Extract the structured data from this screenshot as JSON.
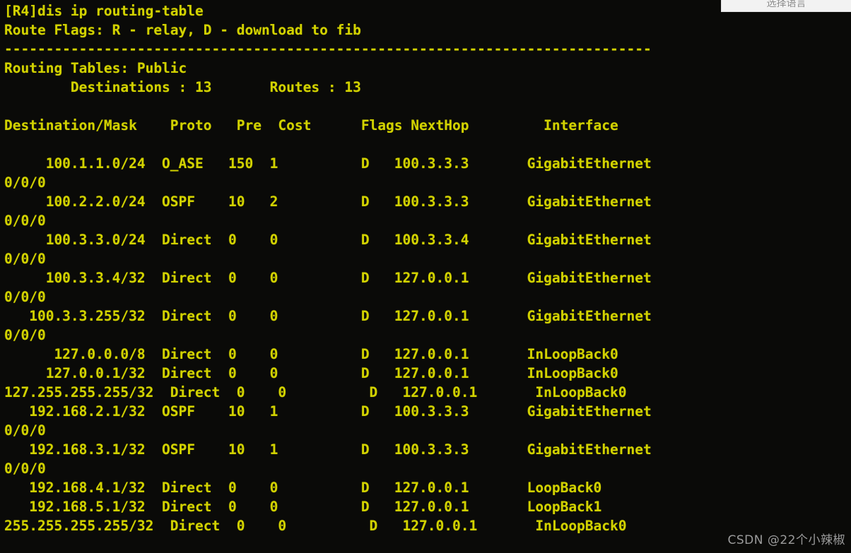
{
  "window": {
    "terminal_bg": "#0a0a08",
    "terminal_fg": "#d2d200"
  },
  "language_selector": {
    "label": "选择语言"
  },
  "watermark": {
    "text": "CSDN @22个小辣椒"
  },
  "terminal": {
    "prompt_line": "[R4]dis ip routing-table",
    "route_flags_line": "Route Flags: R - relay, D - download to fib",
    "separator": "------------------------------------------------------------------------------",
    "routing_tables_line": "Routing Tables: Public",
    "summary_line": "        Destinations : 13       Routes : 13",
    "destinations_label": "Destinations",
    "destinations_count": "13",
    "routes_label": "Routes",
    "routes_count": "13",
    "header_line": "Destination/Mask    Proto   Pre  Cost      Flags NextHop         Interface",
    "columns": [
      "Destination/Mask",
      "Proto",
      "Pre",
      "Cost",
      "Flags",
      "NextHop",
      "Interface"
    ],
    "rows": [
      {
        "destination": "100.1.1.0/24",
        "proto": "O_ASE",
        "pre": "150",
        "cost": "1",
        "flags": "D",
        "nexthop": "100.3.3.3",
        "interface": "GigabitEthernet",
        "interface_wrap": "0/0/0",
        "line": "     100.1.1.0/24  O_ASE   150  1          D   100.3.3.3       GigabitEthernet",
        "wrap_line": "0/0/0"
      },
      {
        "destination": "100.2.2.0/24",
        "proto": "OSPF",
        "pre": "10",
        "cost": "2",
        "flags": "D",
        "nexthop": "100.3.3.3",
        "interface": "GigabitEthernet",
        "interface_wrap": "0/0/0",
        "line": "     100.2.2.0/24  OSPF    10   2          D   100.3.3.3       GigabitEthernet",
        "wrap_line": "0/0/0"
      },
      {
        "destination": "100.3.3.0/24",
        "proto": "Direct",
        "pre": "0",
        "cost": "0",
        "flags": "D",
        "nexthop": "100.3.3.4",
        "interface": "GigabitEthernet",
        "interface_wrap": "0/0/0",
        "line": "     100.3.3.0/24  Direct  0    0          D   100.3.3.4       GigabitEthernet",
        "wrap_line": "0/0/0"
      },
      {
        "destination": "100.3.3.4/32",
        "proto": "Direct",
        "pre": "0",
        "cost": "0",
        "flags": "D",
        "nexthop": "127.0.0.1",
        "interface": "GigabitEthernet",
        "interface_wrap": "0/0/0",
        "line": "     100.3.3.4/32  Direct  0    0          D   127.0.0.1       GigabitEthernet",
        "wrap_line": "0/0/0"
      },
      {
        "destination": "100.3.3.255/32",
        "proto": "Direct",
        "pre": "0",
        "cost": "0",
        "flags": "D",
        "nexthop": "127.0.0.1",
        "interface": "GigabitEthernet",
        "interface_wrap": "0/0/0",
        "line": "   100.3.3.255/32  Direct  0    0          D   127.0.0.1       GigabitEthernet",
        "wrap_line": "0/0/0"
      },
      {
        "destination": "127.0.0.0/8",
        "proto": "Direct",
        "pre": "0",
        "cost": "0",
        "flags": "D",
        "nexthop": "127.0.0.1",
        "interface": "InLoopBack0",
        "interface_wrap": "",
        "line": "      127.0.0.0/8  Direct  0    0          D   127.0.0.1       InLoopBack0",
        "wrap_line": ""
      },
      {
        "destination": "127.0.0.1/32",
        "proto": "Direct",
        "pre": "0",
        "cost": "0",
        "flags": "D",
        "nexthop": "127.0.0.1",
        "interface": "InLoopBack0",
        "interface_wrap": "",
        "line": "     127.0.0.1/32  Direct  0    0          D   127.0.0.1       InLoopBack0",
        "wrap_line": ""
      },
      {
        "destination": "127.255.255.255/32",
        "proto": "Direct",
        "pre": "0",
        "cost": "0",
        "flags": "D",
        "nexthop": "127.0.0.1",
        "interface": "InLoopBack0",
        "interface_wrap": "",
        "line": "127.255.255.255/32  Direct  0    0          D   127.0.0.1       InLoopBack0",
        "wrap_line": ""
      },
      {
        "destination": "192.168.2.1/32",
        "proto": "OSPF",
        "pre": "10",
        "cost": "1",
        "flags": "D",
        "nexthop": "100.3.3.3",
        "interface": "GigabitEthernet",
        "interface_wrap": "0/0/0",
        "line": "   192.168.2.1/32  OSPF    10   1          D   100.3.3.3       GigabitEthernet",
        "wrap_line": "0/0/0"
      },
      {
        "destination": "192.168.3.1/32",
        "proto": "OSPF",
        "pre": "10",
        "cost": "1",
        "flags": "D",
        "nexthop": "100.3.3.3",
        "interface": "GigabitEthernet",
        "interface_wrap": "0/0/0",
        "line": "   192.168.3.1/32  OSPF    10   1          D   100.3.3.3       GigabitEthernet",
        "wrap_line": "0/0/0"
      },
      {
        "destination": "192.168.4.1/32",
        "proto": "Direct",
        "pre": "0",
        "cost": "0",
        "flags": "D",
        "nexthop": "127.0.0.1",
        "interface": "LoopBack0",
        "interface_wrap": "",
        "line": "   192.168.4.1/32  Direct  0    0          D   127.0.0.1       LoopBack0",
        "wrap_line": ""
      },
      {
        "destination": "192.168.5.1/32",
        "proto": "Direct",
        "pre": "0",
        "cost": "0",
        "flags": "D",
        "nexthop": "127.0.0.1",
        "interface": "LoopBack1",
        "interface_wrap": "",
        "line": "   192.168.5.1/32  Direct  0    0          D   127.0.0.1       LoopBack1",
        "wrap_line": ""
      },
      {
        "destination": "255.255.255.255/32",
        "proto": "Direct",
        "pre": "0",
        "cost": "0",
        "flags": "D",
        "nexthop": "127.0.0.1",
        "interface": "InLoopBack0",
        "interface_wrap": "",
        "line": "255.255.255.255/32  Direct  0    0          D   127.0.0.1       InLoopBack0",
        "wrap_line": ""
      }
    ]
  }
}
